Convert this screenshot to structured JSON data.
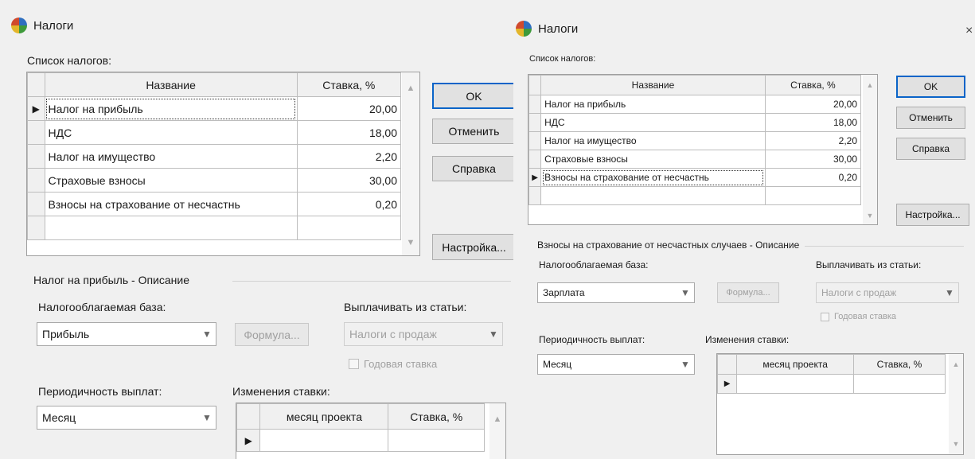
{
  "left": {
    "title": "Налоги",
    "taxes_list_label": "Список налогов:",
    "columns": {
      "name": "Название",
      "rate": "Ставка, %"
    },
    "rows": [
      {
        "name": "Налог на прибыль",
        "rate": "20,00"
      },
      {
        "name": "НДС",
        "rate": "18,00"
      },
      {
        "name": "Налог на имущество",
        "rate": "2,20"
      },
      {
        "name": "Страховые взносы",
        "rate": "30,00"
      },
      {
        "name": "Взносы на страхование от несчастнь",
        "rate": "0,20"
      }
    ],
    "buttons": {
      "ok": "OK",
      "cancel": "Отменить",
      "help": "Справка",
      "settings": "Настройка..."
    },
    "description_title": "Налог на прибыль - Описание",
    "tax_base_label": "Налогооблагаемая база:",
    "tax_base_value": "Прибыль",
    "formula_button": "Формула...",
    "pay_from_label": "Выплачивать из статьи:",
    "pay_from_value": "Налоги с продаж",
    "annual_rate_label": "Годовая ставка",
    "periodicity_label": "Периодичность выплат:",
    "periodicity_value": "Месяц",
    "rate_changes_label": "Изменения ставки:",
    "changes_columns": {
      "month": "месяц проекта",
      "rate": "Ставка, %"
    }
  },
  "right": {
    "title": "Налоги",
    "taxes_list_label": "Список налогов:",
    "columns": {
      "name": "Название",
      "rate": "Ставка, %"
    },
    "rows": [
      {
        "name": "Налог на прибыль",
        "rate": "20,00"
      },
      {
        "name": "НДС",
        "rate": "18,00"
      },
      {
        "name": "Налог на имущество",
        "rate": "2,20"
      },
      {
        "name": "Страховые взносы",
        "rate": "30,00"
      },
      {
        "name": "Взносы на страхование от несчастнь",
        "rate": "0,20"
      }
    ],
    "buttons": {
      "ok": "OK",
      "cancel": "Отменить",
      "help": "Справка",
      "settings": "Настройка..."
    },
    "description_title": "Взносы на страхование от несчастных случаев - Описание",
    "tax_base_label": "Налогооблагаемая база:",
    "tax_base_value": "Зарплата",
    "formula_button": "Формула...",
    "pay_from_label": "Выплачивать из статьи:",
    "pay_from_value": "Налоги с продаж",
    "annual_rate_label": "Годовая ставка",
    "periodicity_label": "Периодичность выплат:",
    "periodicity_value": "Месяц",
    "rate_changes_label": "Изменения ставки:",
    "changes_columns": {
      "month": "месяц проекта",
      "rate": "Ставка, %"
    }
  },
  "icons": {
    "app": "pie-chart-icon",
    "close": "close-icon",
    "row_pointer": "row-pointer-icon",
    "dropdown": "chevron-down-icon"
  }
}
